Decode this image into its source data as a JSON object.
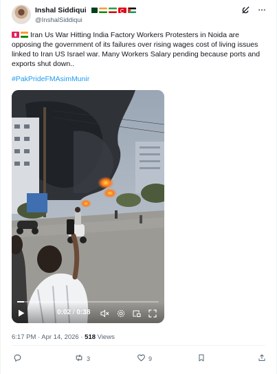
{
  "author": {
    "display_name": "Inshal Siddiqui",
    "handle": "@InshalSiddiqui",
    "flags": [
      "pakistan-flag",
      "india-flag",
      "iran-flag",
      "turkey-flag",
      "palestine-flag"
    ]
  },
  "header": {
    "grok_icon": "grok-icon",
    "more_icon": "more-icon"
  },
  "tweet": {
    "text": "Iran Us War Hitting India Factory Workers Protesters in Noida are opposing the government of its failures over rising wages  cost of living issues linked to Iran US Israel war. Many Workers Salary pending because ports and exports shut down..",
    "hashtag": "#PakPrideFMAsimMunir"
  },
  "video": {
    "current_time": "0:02",
    "separator": " / ",
    "duration": "0:38",
    "progress_fraction": 0.05,
    "icons": [
      "play-icon",
      "mute-icon",
      "settings-icon",
      "pip-icon",
      "fullscreen-icon"
    ]
  },
  "meta": {
    "timestamp": "6:17 PM · Apr 14, 2026",
    "dot": " · ",
    "views_count": "518",
    "views_label": "Views"
  },
  "actions": {
    "reply_count": "",
    "repost_count": "3",
    "like_count": "9"
  },
  "colors": {
    "accent": "#1d9bf0",
    "text": "#0f1419",
    "muted": "#536471"
  }
}
